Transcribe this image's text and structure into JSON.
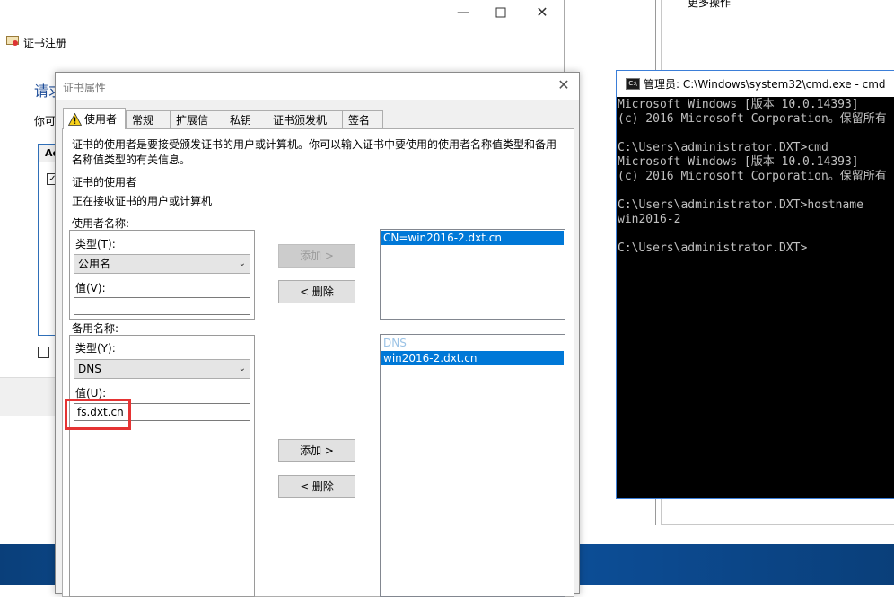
{
  "background": {
    "more_actions": "更多操作"
  },
  "wizard": {
    "title": "证书注册",
    "heading": "请求",
    "text": "你可",
    "list_header": "Ac"
  },
  "dialog": {
    "title": "证书属性",
    "tabs": [
      {
        "label": "使用者",
        "active": true
      },
      {
        "label": "常规"
      },
      {
        "label": "扩展信息"
      },
      {
        "label": "私钥"
      },
      {
        "label": "证书颁发机构"
      },
      {
        "label": "签名"
      }
    ],
    "description_line1": "证书的使用者是要接受颁发证书的用户或计算机。你可以输入证书中要使用的使用者名称值类型和备用",
    "description_line2": "名称值类型的有关信息。",
    "subject_heading": "证书的使用者",
    "subject_desc": "正在接收证书的用户或计算机",
    "subject_name": {
      "group_label": "使用者名称:",
      "type_label": "类型(T):",
      "type_value": "公用名",
      "value_label": "值(V):",
      "value": "",
      "add_button": "添加 >",
      "remove_button": "< 删除",
      "list_items": [
        {
          "text": "CN=win2016-2.dxt.cn",
          "selected": true
        }
      ]
    },
    "alt_name": {
      "group_label": "备用名称:",
      "type_label": "类型(Y):",
      "type_value": "DNS",
      "value_label": "值(U):",
      "value": "fs.dxt.cn",
      "add_button": "添加 >",
      "remove_button": "< 删除",
      "list_items": [
        {
          "text": "DNS",
          "header": true
        },
        {
          "text": "win2016-2.dxt.cn",
          "selected": true
        }
      ]
    },
    "highlight_color": "#e53333"
  },
  "cmd": {
    "title": "管理员: C:\\Windows\\system32\\cmd.exe - cmd",
    "icon_text": "C:\\",
    "lines": [
      "Microsoft Windows [版本 10.0.14393]",
      "(c) 2016 Microsoft Corporation。保留所有",
      "",
      "C:\\Users\\administrator.DXT>cmd",
      "Microsoft Windows [版本 10.0.14393]",
      "(c) 2016 Microsoft Corporation。保留所有",
      "",
      "C:\\Users\\administrator.DXT>hostname",
      "win2016-2",
      "",
      "C:\\Users\\administrator.DXT>"
    ]
  }
}
